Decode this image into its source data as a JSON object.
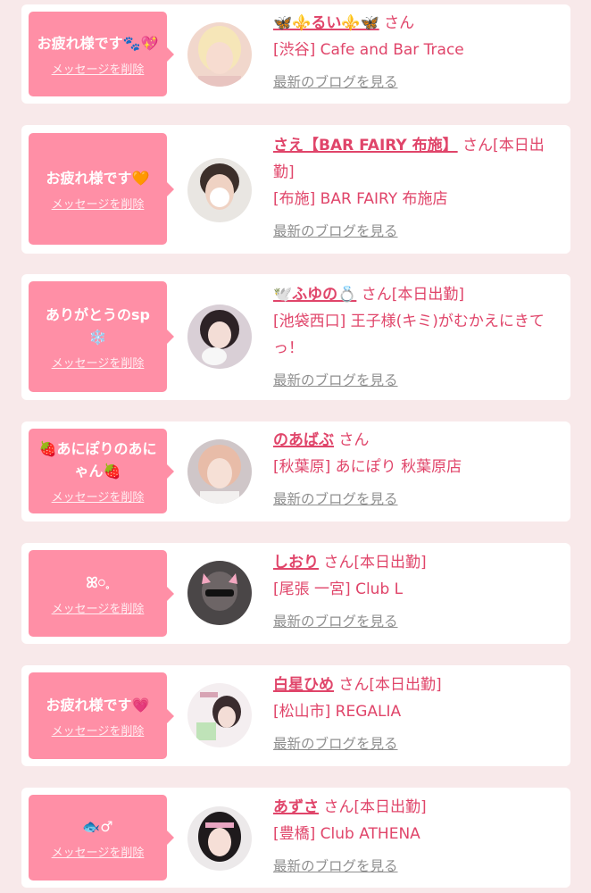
{
  "colors": {
    "page_background": "#f8e9ea",
    "bubble": "#ff8fa6",
    "accent_text": "#e0456a",
    "blog_link": "#8f8f8f"
  },
  "messages": [
    {
      "bubble_text": "お疲れ様です🐾💖",
      "delete_label": "メッセージを削除",
      "name": "🦋⚜️るい⚜️🦋",
      "suffix": "さん",
      "shop": "[渋谷] Cafe and Bar Trace",
      "blog_label": "最新のブログを見る",
      "avatar_icon": "avatar-photo"
    },
    {
      "bubble_text": "お疲れ様です🧡",
      "delete_label": "メッセージを削除",
      "name": "さえ【BAR FAIRY 布施】",
      "suffix": "さん[本日出勤]",
      "shop": "[布施] BAR FAIRY 布施店",
      "blog_label": "最新のブログを見る",
      "avatar_icon": "avatar-photo"
    },
    {
      "bubble_text": "ありがとうのsp❄️",
      "delete_label": "メッセージを削除",
      "name": "🕊️ふゆの💍",
      "suffix": "さん[本日出勤]",
      "shop": "[池袋西口] 王子様(キミ)がむかえにきてっ！",
      "blog_label": "最新のブログを見る",
      "avatar_icon": "avatar-photo"
    },
    {
      "bubble_text": "🍓あにぽりのあにゃん🍓",
      "delete_label": "メッセージを削除",
      "name": "のあばぶ",
      "suffix": "さん",
      "shop": "[秋葉原] あにぽり 秋葉原店",
      "blog_label": "最新のブログを見る",
      "avatar_icon": "avatar-photo"
    },
    {
      "bubble_text": "ꕤ𓏸𓈒",
      "delete_label": "メッセージを削除",
      "name": "しおり",
      "suffix": "さん[本日出勤]",
      "shop": "[尾張 一宮] Club L",
      "blog_label": "最新のブログを見る",
      "avatar_icon": "avatar-photo"
    },
    {
      "bubble_text": "お疲れ様です💗",
      "delete_label": "メッセージを削除",
      "name": "白星ひめ",
      "suffix": "さん[本日出勤]",
      "shop": "[松山市] REGALIA",
      "blog_label": "最新のブログを見る",
      "avatar_icon": "avatar-photo"
    },
    {
      "bubble_text": "🐟♂",
      "delete_label": "メッセージを削除",
      "name": "あずさ",
      "suffix": "さん[本日出勤]",
      "shop": "[豊橋] Club ATHENA",
      "blog_label": "最新のブログを見る",
      "avatar_icon": "avatar-photo"
    }
  ]
}
